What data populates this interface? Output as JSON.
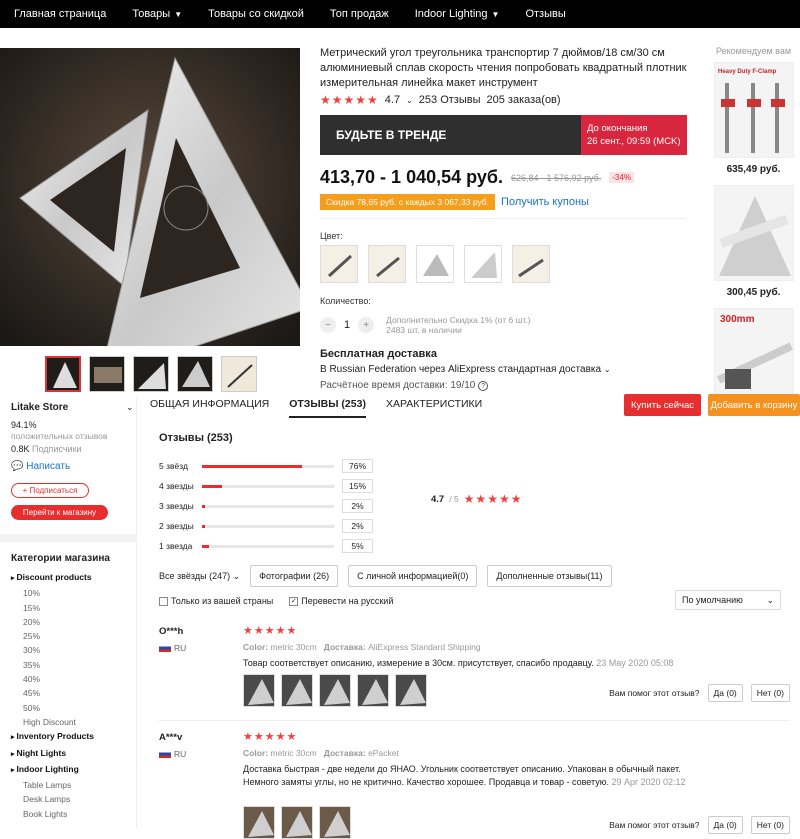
{
  "nav": {
    "items": [
      {
        "label": "Главная страница",
        "chev": false
      },
      {
        "label": "Товары",
        "chev": true
      },
      {
        "label": "Товары со скидкой",
        "chev": false
      },
      {
        "label": "Топ продаж",
        "chev": false
      },
      {
        "label": "Indoor Lighting",
        "chev": true
      },
      {
        "label": "Отзывы",
        "chev": false
      }
    ]
  },
  "product": {
    "title": "Метрический угол треугольника транспортир 7 дюймов/18 см/30 см алюминиевый сплав скорость чтения попробовать квадратный плотник измерительная линейка макет инструмент",
    "rating": "4.7",
    "reviews_count": "253 Отзывы",
    "orders": "205 заказа(ов)",
    "banner_left": "БУДЬТЕ В ТРЕНДЕ",
    "banner_right_1": "До окончания",
    "banner_right_2": "26 сент., 09:59 (MCK)",
    "price": "413,70 - 1 040,54 руб.",
    "old_price": "626,84 - 1 576,92 руб.",
    "discount": "-34%",
    "coupon_tag": "Скидка 78,65 руб. с каждых 3 067,33 руб.",
    "coupon_link": "Получить купоны",
    "color_label": "Цвет:",
    "qty_label": "Количество:",
    "qty_value": "1",
    "qty_note_1": "Дополнительно Скидка 1% (от 6 шт.)",
    "qty_note_2": "2483 шт. в наличии",
    "ship_title": "Бесплатная доставка",
    "ship_line": "В Russian Federation через AliExpress стандартная доставка",
    "ship_eta": "Расчётное время доставки: 19/10"
  },
  "recommend": {
    "title": "Рекомендуем вам",
    "items": [
      {
        "label": "Heavy Duty F-Clamp",
        "price": "635,49 руб."
      },
      {
        "label": "",
        "price": "300,45 руб."
      },
      {
        "label": "300mm",
        "price": ""
      }
    ]
  },
  "tabs": [
    {
      "label": "ОБЩАЯ ИНФОРМАЦИЯ"
    },
    {
      "label": "ОТЗЫВЫ (253)"
    },
    {
      "label": "ХАРАКТЕРИСТИКИ"
    }
  ],
  "actions": {
    "buy": "Купить сейчас",
    "cart": "Добавить в корзину"
  },
  "store": {
    "name": "Litake Store",
    "positive_pct": "94.1%",
    "positive_label": "положительных отзывов",
    "subscribers": "0.8K",
    "subscribers_label": "Подписчики",
    "write": "Написать",
    "subscribe": "+ Подписаться",
    "go_shop": "Перейти к магазину",
    "cat_title": "Категории магазина",
    "categories": [
      {
        "label": "Discount products",
        "group": true
      },
      {
        "label": "10%",
        "group": false
      },
      {
        "label": "15%",
        "group": false
      },
      {
        "label": "20%",
        "group": false
      },
      {
        "label": "25%",
        "group": false
      },
      {
        "label": "30%",
        "group": false
      },
      {
        "label": "35%",
        "group": false
      },
      {
        "label": "40%",
        "group": false
      },
      {
        "label": "45%",
        "group": false
      },
      {
        "label": "50%",
        "group": false
      },
      {
        "label": "High Discount",
        "group": false
      },
      {
        "label": "Inventory Products",
        "group": true
      },
      {
        "label": "Night Lights",
        "group": true
      },
      {
        "label": "Indoor Lighting",
        "group": true
      },
      {
        "label": "Table Lamps",
        "group": false
      },
      {
        "label": "Desk Lamps",
        "group": false
      },
      {
        "label": "Book Lights",
        "group": false
      }
    ]
  },
  "reviews": {
    "title": "Отзывы (253)",
    "bars": [
      {
        "label": "5 звёзд",
        "pct": "76%",
        "value": 0.76
      },
      {
        "label": "4 звезды",
        "pct": "15%",
        "value": 0.15
      },
      {
        "label": "3 звезды",
        "pct": "2%",
        "value": 0.02
      },
      {
        "label": "2 звезды",
        "pct": "2%",
        "value": 0.02
      },
      {
        "label": "1 звезда",
        "pct": "5%",
        "value": 0.05
      }
    ],
    "avg": "4.7",
    "avg_of": "/ 5",
    "filter_all": "Все звёзды (247)",
    "filter_photos": "Фотографии (26)",
    "filter_personal": "С личной информацией(0)",
    "filter_extra": "Дополненные отзывы(11)",
    "check_country": "Только из вашей страны",
    "check_translate": "Перевести на русский",
    "sort": "По умолчанию",
    "helpful_q": "Вам помог этот отзыв?",
    "yes": "Да (0)",
    "no": "Нет (0)",
    "list": [
      {
        "author": "O***h",
        "country": "RU",
        "color": "metric 30cm",
        "delivery": "AliExpress Standard Shipping",
        "text": "Товар соответствует описанию, измерение в 30см. присутствует, спасибо продавцу.",
        "date": "23 May 2020 05:08",
        "photos": 5
      },
      {
        "author": "A***v",
        "country": "RU",
        "color": "metric 30cm",
        "delivery": "ePacket",
        "text": "Доставка быстрая - две недели до ЯНАО. Угольник соответствует описанию. Упакован в обычный пакет. Немного замяты углы, но не критично. Качество хорошее. Продавца и товар - советую.",
        "date": "29 Apr 2020 02:12",
        "photos": 3
      }
    ]
  }
}
